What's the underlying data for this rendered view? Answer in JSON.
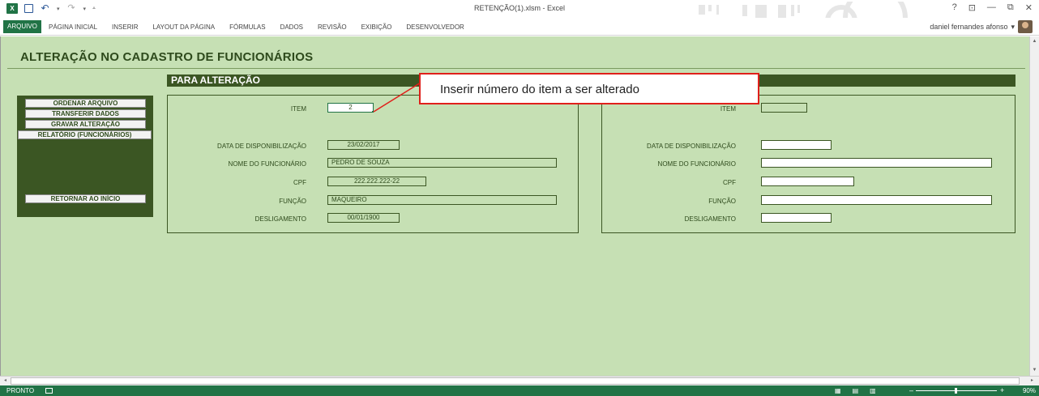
{
  "window": {
    "title": "RETENÇÃO(1).xlsm - Excel",
    "logo": "X",
    "controls": [
      "?",
      "⊡",
      "—",
      "⧉",
      "✕"
    ]
  },
  "ribbon": {
    "file_tab": "ARQUIVO",
    "tabs": [
      "PÁGINA INICIAL",
      "INSERIR",
      "LAYOUT DA PÁGINA",
      "FÓRMULAS",
      "DADOS",
      "REVISÃO",
      "EXIBIÇÃO",
      "DESENVOLVEDOR"
    ],
    "user": "daniel fernandes afonso",
    "accent": "#217346"
  },
  "sheet": {
    "title": "ALTERAÇÃO NO CADASTRO DE FUNCIONÁRIOS",
    "section_header": "PARA ALTERAÇÃO",
    "background": "#c6e0b4",
    "dark_green": "#3b5623",
    "menu": [
      "ORDENAR ARQUIVO",
      "TRANSFERIR DADOS",
      "GRAVAR ALTERAÇÃO",
      "RELATÓRIO (FUNCIONÁRIOS)",
      "RETORNAR AO INÍCIO"
    ],
    "labels": {
      "item": "ITEM",
      "data": "DATA DE DISPONIBILIZAÇÃO",
      "nome": "NOME DO FUNCIONÁRIO",
      "cpf": "CPF",
      "funcao": "FUNÇÃO",
      "desligamento": "DESLIGAMENTO"
    },
    "left_values": {
      "item": "2",
      "data": "23/02/2017",
      "nome": "PEDRO DE SOUZA",
      "cpf": "222.222.222-22",
      "funcao": "MAQUEIRO",
      "desligamento": "00/01/1900"
    },
    "right_values": {
      "item": "",
      "data": "",
      "nome": "",
      "cpf": "",
      "funcao": "",
      "desligamento": ""
    },
    "callout": "Inserir número do item a ser alterado",
    "callout_color": "#e0201b"
  },
  "statusbar": {
    "status": "PRONTO",
    "zoom": "90%"
  }
}
